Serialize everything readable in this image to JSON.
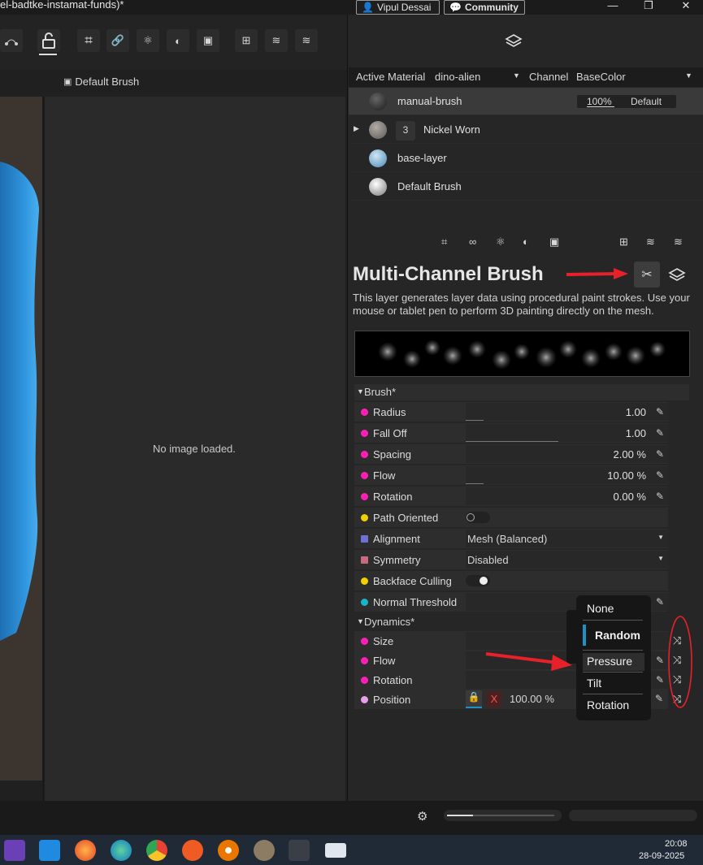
{
  "title": "el-badtke-instamat-funds)*",
  "top_buttons": {
    "user": "Vipul Dessai",
    "community": "Community"
  },
  "window_controls": {
    "minimize": "—",
    "restore": "❐",
    "close": "✕"
  },
  "left": {
    "tab_label": "Default Brush",
    "no_image": "No image loaded."
  },
  "material_bar": {
    "active_material_label": "Active Material",
    "active_material_value": "dino-alien",
    "channel_label": "Channel",
    "channel_value": "BaseColor"
  },
  "layers": [
    {
      "name": "manual-brush",
      "opacity": "100%",
      "blend": "Default",
      "ball": "#1a1a1a"
    },
    {
      "name": "Nickel Worn",
      "count": "3",
      "ball": "#8a8580"
    },
    {
      "name": "base-layer",
      "ball": "#7fb6d9"
    },
    {
      "name": "Default Brush",
      "ball": "#e8e8e8"
    }
  ],
  "brush_panel": {
    "title": "Multi-Channel Brush",
    "description": "This layer generates layer data using procedural paint strokes. Use your mouse or tablet pen to perform 3D painting directly on the mesh."
  },
  "brush_section": {
    "header": "Brush*",
    "props": [
      {
        "label": "Radius",
        "value": "1.00",
        "color": "#ff1fb4"
      },
      {
        "label": "Fall Off",
        "value": "1.00",
        "color": "#ff1fb4"
      },
      {
        "label": "Spacing",
        "value": "2.00 %",
        "color": "#ff1fb4"
      },
      {
        "label": "Flow",
        "value": "10.00 %",
        "color": "#ff1fb4"
      },
      {
        "label": "Rotation",
        "value": "0.00 %",
        "color": "#ff1fb4"
      }
    ],
    "path_oriented": "Path Oriented",
    "alignment_label": "Alignment",
    "alignment_value": "Mesh (Balanced)",
    "symmetry_label": "Symmetry",
    "symmetry_value": "Disabled",
    "backface_label": "Backface Culling",
    "normal_label": "Normal Threshold"
  },
  "dynamics": {
    "header": "Dynamics*",
    "size": "Size",
    "flow": "Flow",
    "rotation": "Rotation",
    "position": "Position",
    "x_label": "X",
    "x_value": "100.00 %"
  },
  "popup": {
    "items": [
      "None",
      "Random",
      "Pressure",
      "Tilt",
      "Rotation"
    ]
  },
  "taskbar": {
    "time": "20:08",
    "date": "28-09-2025"
  },
  "colors": {
    "accent": "#1e90c8",
    "pink": "#ff1fb4",
    "yellow": "#f2d000",
    "cyan": "#18b5c6",
    "red_arrow": "#e8202a"
  }
}
